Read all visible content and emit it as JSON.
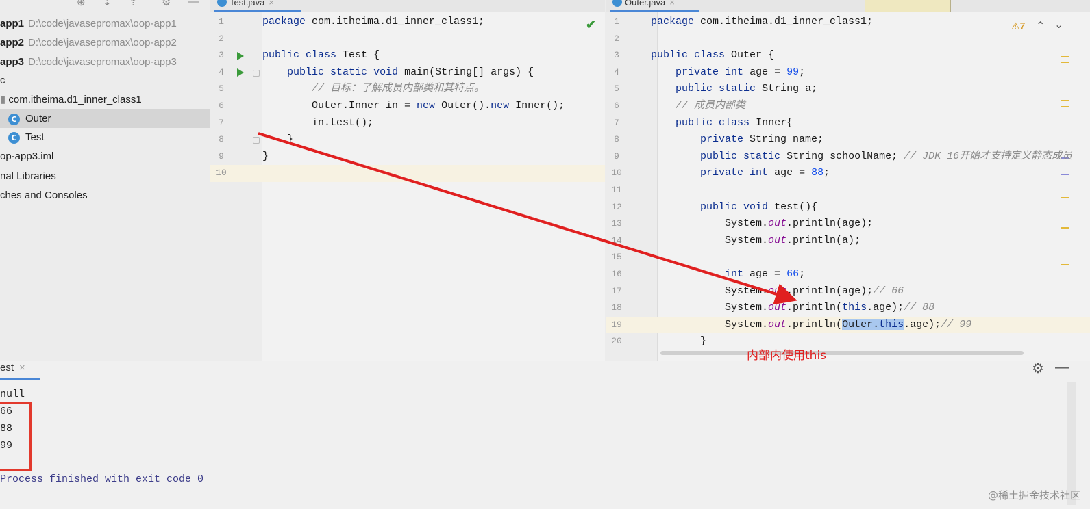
{
  "project": {
    "rows": [
      {
        "name": "app1",
        "path": "D:\\code\\javasepromax\\oop-app1"
      },
      {
        "name": "app2",
        "path": "D:\\code\\javasepromax\\oop-app2"
      },
      {
        "name": "app3",
        "path": "D:\\code\\javasepromax\\oop-app3"
      },
      {
        "name": "c"
      },
      {
        "name": "com.itheima.d1_inner_class1"
      },
      {
        "name": "Outer"
      },
      {
        "name": "Test"
      },
      {
        "name": "op-app3.iml"
      },
      {
        "name": "nal Libraries"
      },
      {
        "name": "ches and Consoles"
      }
    ]
  },
  "left_editor": {
    "tab": "Test.java",
    "lines": [
      "package com.itheima.d1_inner_class1;",
      "",
      "public class Test {",
      "    public static void main(String[] args) {",
      "        // 目标：了解成员内部类和其特点。",
      "        Outer.Inner in = new Outer().new Inner();",
      "        in.test();",
      "    }",
      "}",
      ""
    ]
  },
  "right_editor": {
    "tab": "Outer.java",
    "warnings": "⚠7",
    "line_numbers": [
      "1",
      "2",
      "3",
      "4",
      "5",
      "6",
      "7",
      "8",
      "9",
      "10",
      "11",
      "12",
      "13",
      "14",
      "15",
      "16",
      "17",
      "18",
      "19",
      "20"
    ],
    "lines": [
      "package com.itheima.d1_inner_class1;",
      "",
      "public class Outer {",
      "    private int age = 99;",
      "    public static String a;",
      "    // 成员内部类",
      "    public class Inner{",
      "        private String name;",
      "        public static String schoolName; // JDK 16开始才支持定义静态成员",
      "        private int age = 88;",
      "",
      "        public void test(){",
      "            System.out.println(age);",
      "            System.out.println(a);",
      "",
      "            int age = 66;",
      "            System.out.println(age);// 66",
      "            System.out.println(this.age);// 88",
      "            System.out.println(Outer.this.age);// 99",
      "        }"
    ]
  },
  "run": {
    "tab": "est",
    "output": [
      "null",
      "66",
      "88",
      "99",
      "",
      "Process finished with exit code 0"
    ]
  },
  "annotation": "内部内使用this",
  "watermark": "@稀土掘金技术社区",
  "colors": {
    "arrow": "#e02020",
    "selection": "#a9c8ef"
  }
}
